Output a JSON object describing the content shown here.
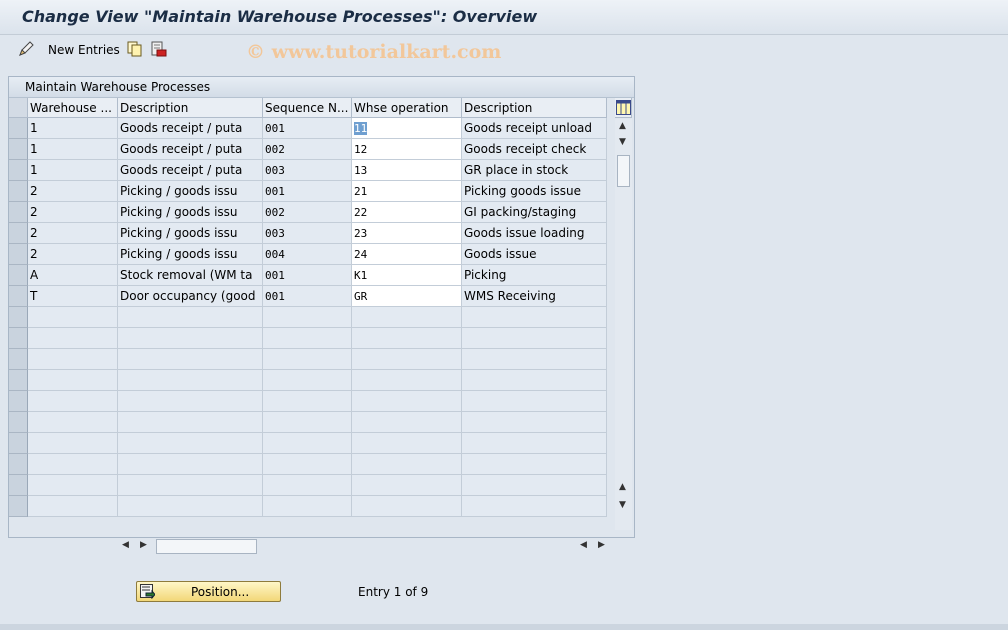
{
  "window": {
    "title": "Change View \"Maintain Warehouse Processes\": Overview"
  },
  "toolbar": {
    "new_entries_label": "New Entries",
    "watermark": "© www.tutorialkart.com"
  },
  "table": {
    "title": "Maintain Warehouse Processes",
    "columns": [
      "Warehouse ...",
      "Description",
      "Sequence N...",
      "Whse operation",
      "Description"
    ],
    "rows": [
      [
        "1",
        "Goods receipt / puta",
        "001",
        "11",
        "Goods receipt unload"
      ],
      [
        "1",
        "Goods receipt / puta",
        "002",
        "12",
        "Goods receipt check"
      ],
      [
        "1",
        "Goods receipt / puta",
        "003",
        "13",
        "GR place in stock"
      ],
      [
        "2",
        "Picking / goods issu",
        "001",
        "21",
        "Picking goods issue"
      ],
      [
        "2",
        "Picking / goods issu",
        "002",
        "22",
        "GI packing/staging"
      ],
      [
        "2",
        "Picking / goods issu",
        "003",
        "23",
        "Goods issue loading"
      ],
      [
        "2",
        "Picking / goods issu",
        "004",
        "24",
        "Goods issue"
      ],
      [
        "A",
        "Stock removal (WM ta",
        "001",
        "K1",
        "Picking"
      ],
      [
        "T",
        "Door occupancy (good",
        "001",
        "GR",
        "WMS Receiving"
      ]
    ],
    "empty_rows": 10
  },
  "footer": {
    "position_label": "Position...",
    "entry_info": "Entry 1 of 9"
  }
}
